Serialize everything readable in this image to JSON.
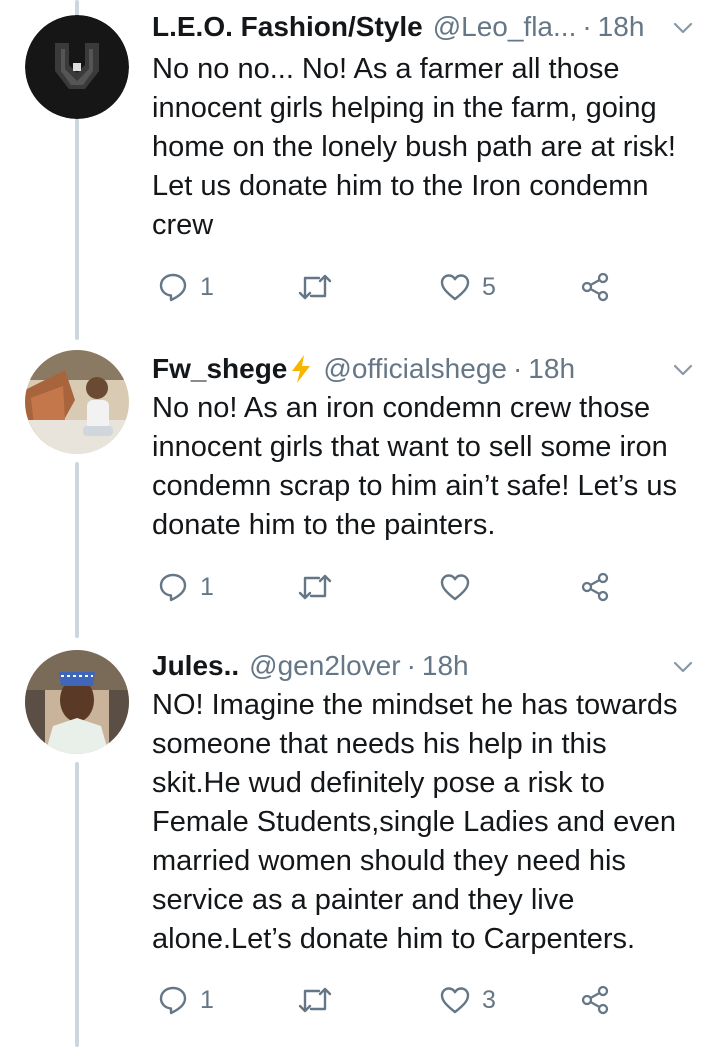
{
  "tweets": [
    {
      "name": "L.E.O. Fashion/Style",
      "handle": "@Leo_fla...",
      "separator": "·",
      "time": "18h",
      "verified_emoji": false,
      "lines": [
        "No no no... No! As a farmer all those",
        "innocent girls helping in the farm, going",
        "home on the lonely bush path are at risk!",
        "Let us donate him to the Iron condemn",
        "crew"
      ],
      "replies": "1",
      "retweets": "",
      "likes": "5"
    },
    {
      "name": "Fw_shege",
      "handle": "@officialshege",
      "separator": "·",
      "time": "18h",
      "verified_emoji": true,
      "lines": [
        "No no! As an iron condemn crew those",
        "innocent girls that want to sell some iron",
        "condemn scrap to him ain’t safe! Let’s us",
        "donate him to the painters."
      ],
      "replies": "1",
      "retweets": "",
      "likes": ""
    },
    {
      "name": "Jules..",
      "handle": "@gen2lover",
      "separator": "·",
      "time": "18h",
      "verified_emoji": false,
      "lines": [
        "NO! Imagine the mindset he has towards",
        "someone that needs his help in this",
        "skit.He wud definitely pose a risk to",
        "Female Students,single Ladies and even",
        "married women should they need his",
        "service as a painter and they live",
        "alone.Let’s donate him to Carpenters."
      ],
      "replies": "1",
      "retweets": "",
      "likes": "3"
    }
  ],
  "icons": {
    "reply": "reply-icon",
    "retweet": "retweet-icon",
    "like": "heart-icon",
    "share": "share-icon",
    "caret": "chevron-down-icon",
    "bolt": "lightning-bolt-icon"
  },
  "colors": {
    "text": "#14171a",
    "secondary": "#657786",
    "thread_line": "#ccd6dd",
    "bolt": "#f7b500"
  }
}
